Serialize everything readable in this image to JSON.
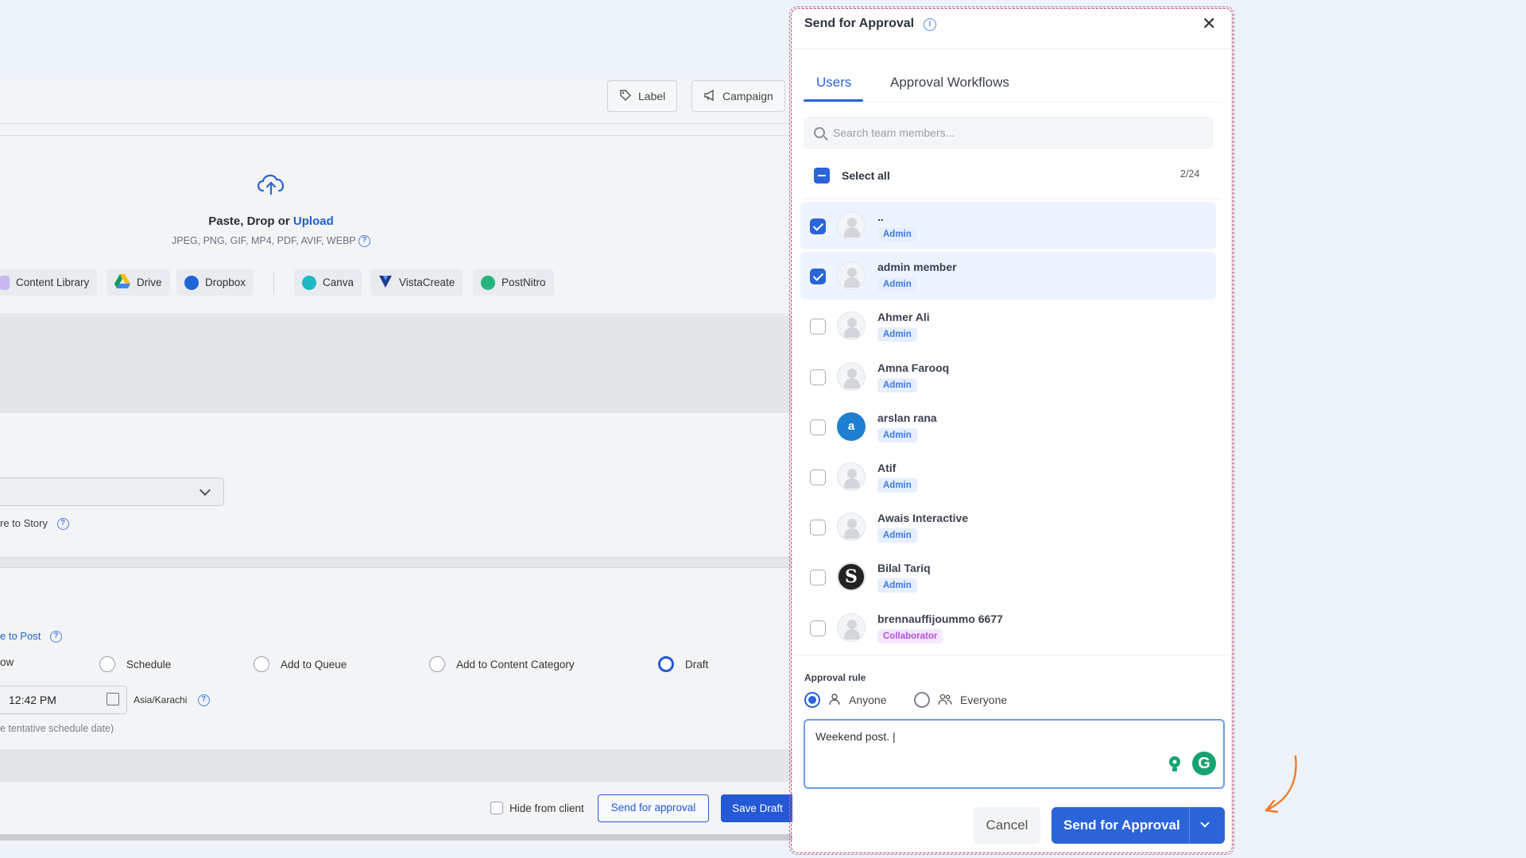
{
  "background": {
    "toolbar": {
      "label_btn": "Label",
      "campaign_btn": "Campaign"
    },
    "upload": {
      "title_prefix": "Paste, Drop or ",
      "title_link": "Upload",
      "formats": "JPEG, PNG, GIF, MP4, PDF, AVIF, WEBP"
    },
    "sources": [
      "Content Library",
      "Drive",
      "Dropbox",
      "Canva",
      "VistaCreate",
      "PostNitro"
    ],
    "story_label": "re to Story",
    "post_label": "e to Post",
    "post_options": [
      "ow",
      "Schedule",
      "Add to Queue",
      "Add to Content Category",
      "Draft"
    ],
    "time_value": "12:42 PM",
    "timezone": "Asia/Karachi",
    "tentative_note": "e tentative schedule date)",
    "hide_from_client": "Hide from client",
    "send_for_approval_btn": "Send for approval",
    "save_draft_btn": "Save Draft"
  },
  "modal": {
    "title": "Send for Approval",
    "info_icon": "i",
    "tabs": [
      {
        "label": "Users",
        "active": true
      },
      {
        "label": "Approval Workflows",
        "active": false
      }
    ],
    "search_placeholder": "Search team members...",
    "select_all_label": "Select all",
    "selected_count": "2/24",
    "users": [
      {
        "name": "..",
        "role": "Admin",
        "checked": true,
        "avatar": "placeholder"
      },
      {
        "name": "admin member",
        "role": "Admin",
        "checked": true,
        "avatar": "placeholder"
      },
      {
        "name": "Ahmer Ali",
        "role": "Admin",
        "checked": false,
        "avatar": "placeholder"
      },
      {
        "name": "Amna Farooq",
        "role": "Admin",
        "checked": false,
        "avatar": "placeholder"
      },
      {
        "name": "arslan rana",
        "role": "Admin",
        "checked": false,
        "avatar": "letter",
        "letter": "a"
      },
      {
        "name": "Atif",
        "role": "Admin",
        "checked": false,
        "avatar": "placeholder"
      },
      {
        "name": "Awais Interactive",
        "role": "Admin",
        "checked": false,
        "avatar": "placeholder"
      },
      {
        "name": "Bilal Tariq",
        "role": "Admin",
        "checked": false,
        "avatar": "logo",
        "letter": "S"
      },
      {
        "name": "brennauffijoummo 6677",
        "role": "Collaborator",
        "checked": false,
        "avatar": "placeholder"
      }
    ],
    "approval_rule_label": "Approval rule",
    "rule_options": [
      {
        "label": "Anyone",
        "selected": true
      },
      {
        "label": "Everyone",
        "selected": false
      }
    ],
    "note_value": "Weekend post. |",
    "grammarly_letter": "G",
    "cancel_btn": "Cancel",
    "send_btn": "Send for Approval"
  },
  "colors": {
    "primary": "#2b64d9",
    "admin_badge": "#3d7ae0",
    "collaborator_badge": "#b052e0",
    "arrow": "#f07a2a"
  }
}
